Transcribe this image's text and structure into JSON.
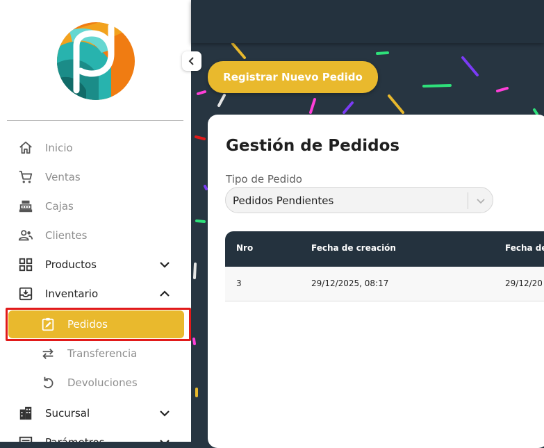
{
  "sidebar": {
    "items": [
      {
        "label": "Inicio",
        "icon": "home-icon"
      },
      {
        "label": "Ventas",
        "icon": "cart-icon"
      },
      {
        "label": "Cajas",
        "icon": "cash-register-icon"
      },
      {
        "label": "Clientes",
        "icon": "users-icon"
      },
      {
        "label": "Productos",
        "icon": "grid-icon"
      },
      {
        "label": "Inventario",
        "icon": "inventory-icon"
      },
      {
        "label": "Pedidos",
        "icon": "clipboard-edit-icon"
      },
      {
        "label": "Transferencia",
        "icon": "transfer-icon"
      },
      {
        "label": "Devoluciones",
        "icon": "undo-icon"
      },
      {
        "label": "Sucursal",
        "icon": "building-icon"
      },
      {
        "label": "Parámetros",
        "icon": "settings-icon"
      }
    ],
    "active_item": "Pedidos"
  },
  "toolbar": {
    "register_button": "Registrar Nuevo Pedido"
  },
  "main": {
    "title": "Gestión de Pedidos",
    "filter": {
      "label": "Tipo de Pedido",
      "value": "Pedidos Pendientes"
    },
    "table": {
      "columns": [
        "Nro",
        "Fecha de creación",
        "Fecha de"
      ],
      "rows": [
        [
          "3",
          "29/12/2025, 08:17",
          "29/12/20"
        ]
      ]
    }
  },
  "colors": {
    "accent": "#e9b92d",
    "dark": "#24323e",
    "highlight": "#e11a1a"
  }
}
